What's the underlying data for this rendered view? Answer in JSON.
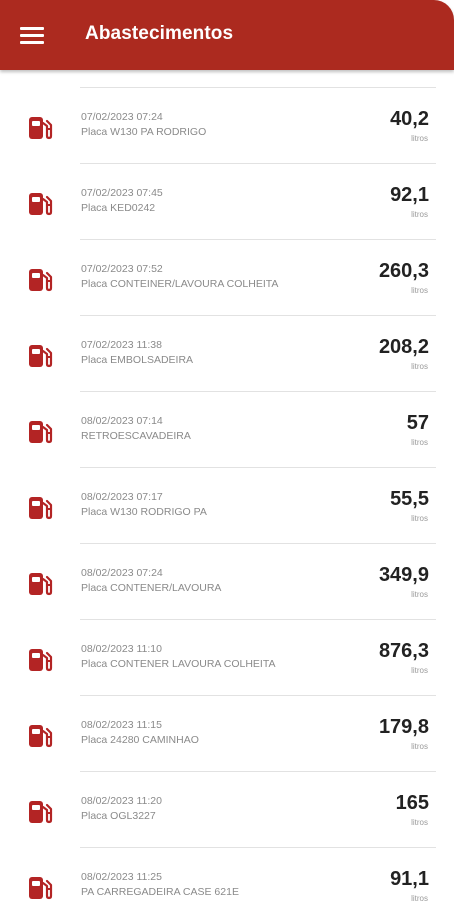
{
  "colors": {
    "appbar": "#ac2a1f",
    "icon": "#b32424"
  },
  "appbar": {
    "title": "Abastecimentos",
    "menu_icon": "hamburger-menu-icon"
  },
  "list": {
    "icon": "fuel-pump-icon",
    "items": [
      {
        "date": "07/02/2023 07:24",
        "desc": "Placa W130 PA RODRIGO",
        "value": "40,2",
        "unit": "litros"
      },
      {
        "date": "07/02/2023 07:45",
        "desc": "Placa KED0242",
        "value": "92,1",
        "unit": "litros"
      },
      {
        "date": "07/02/2023 07:52",
        "desc": "Placa CONTEINER/LAVOURA COLHEITA",
        "value": "260,3",
        "unit": "litros"
      },
      {
        "date": "07/02/2023 11:38",
        "desc": "Placa EMBOLSADEIRA",
        "value": "208,2",
        "unit": "litros"
      },
      {
        "date": "08/02/2023 07:14",
        "desc": "RETROESCAVADEIRA",
        "value": "57",
        "unit": "litros"
      },
      {
        "date": "08/02/2023 07:17",
        "desc": "Placa W130 RODRIGO PA",
        "value": "55,5",
        "unit": "litros"
      },
      {
        "date": "08/02/2023 07:24",
        "desc": "Placa CONTENER/LAVOURA",
        "value": "349,9",
        "unit": "litros"
      },
      {
        "date": "08/02/2023 11:10",
        "desc": "Placa CONTENER LAVOURA COLHEITA",
        "value": "876,3",
        "unit": "litros"
      },
      {
        "date": "08/02/2023 11:15",
        "desc": "Placa 24280 CAMINHAO",
        "value": "179,8",
        "unit": "litros"
      },
      {
        "date": "08/02/2023 11:20",
        "desc": "Placa OGL3227",
        "value": "165",
        "unit": "litros"
      },
      {
        "date": "08/02/2023 11:25",
        "desc": "PA CARREGADEIRA CASE 621E",
        "value": "91,1",
        "unit": "litros"
      }
    ]
  }
}
